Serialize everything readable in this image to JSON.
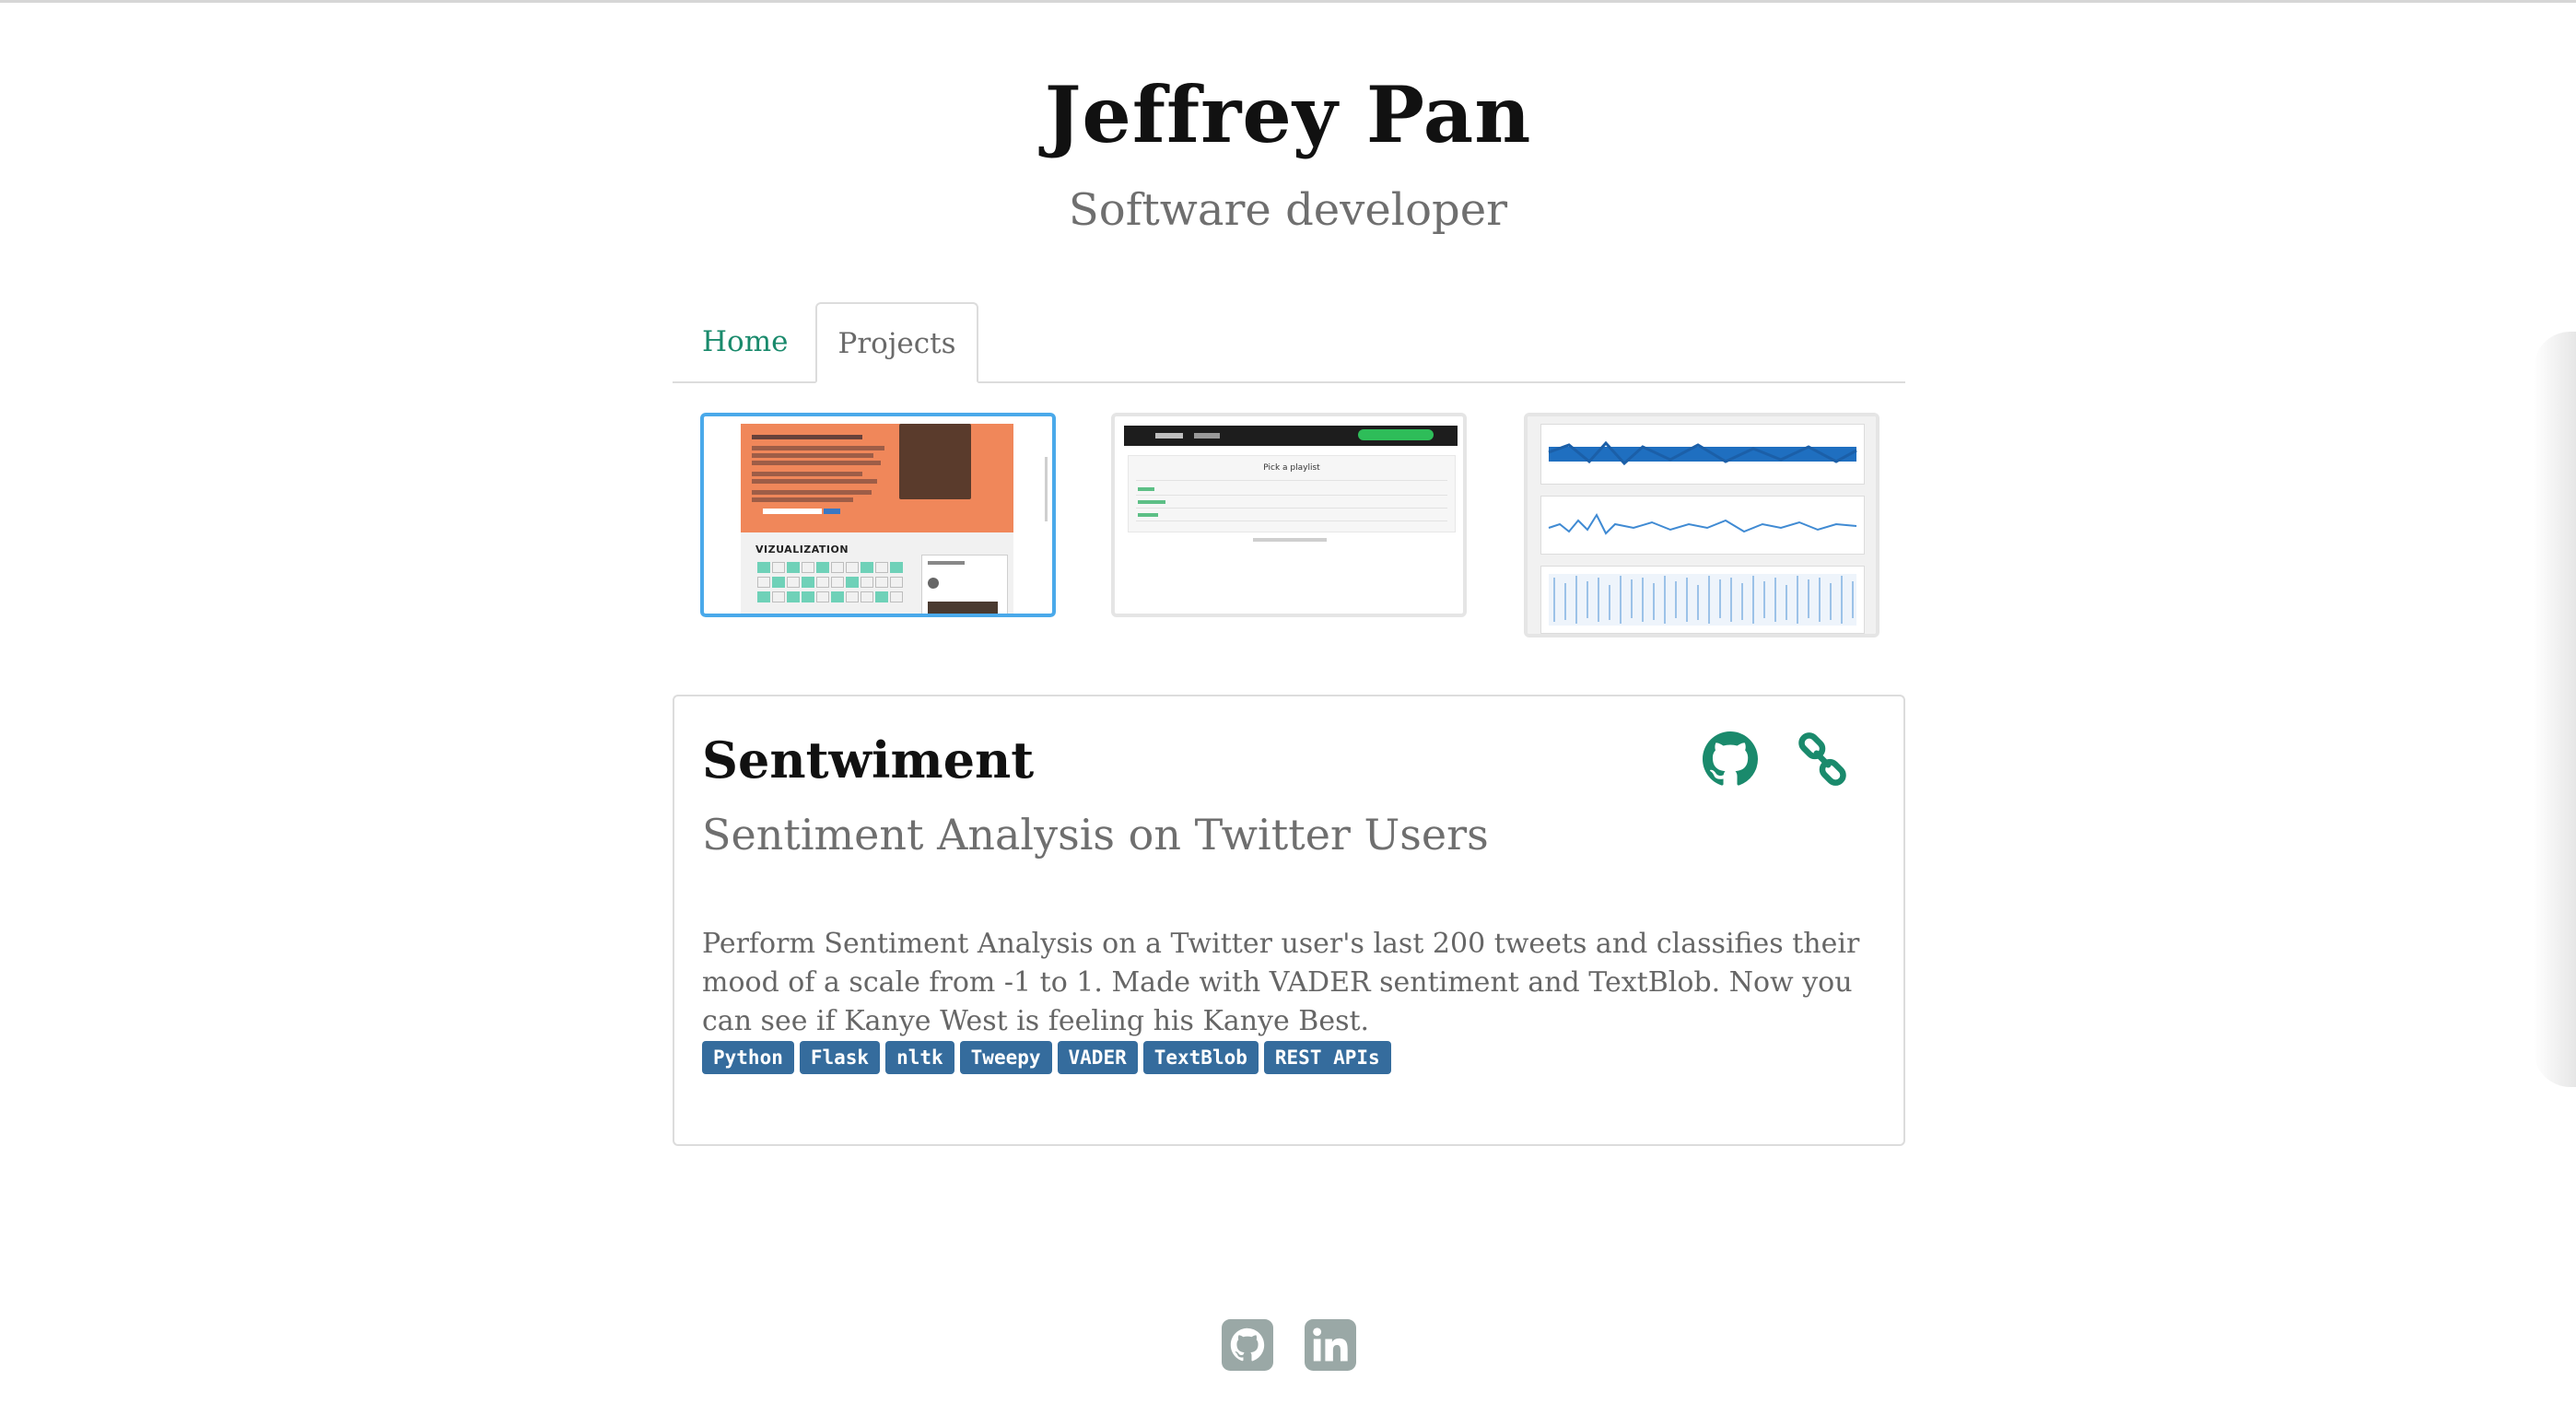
{
  "header": {
    "name": "Jeffrey Pan",
    "role": "Software developer"
  },
  "tabs": [
    {
      "label": "Home",
      "active": false
    },
    {
      "label": "Projects",
      "active": true
    }
  ],
  "carousel": {
    "thumbnails": [
      {
        "name": "sentwiment-screenshot",
        "selected": true,
        "caption": "VIZUALIZATION"
      },
      {
        "name": "spotify-app-screenshot",
        "selected": false,
        "caption": "Pick a playlist"
      },
      {
        "name": "signal-plot-screenshot",
        "selected": false
      }
    ],
    "page_dots": [
      true,
      false
    ]
  },
  "project": {
    "title": "Sentwiment",
    "subtitle": "Sentiment Analysis on Twitter Users",
    "description": "Perform Sentiment Analysis on a Twitter user's last 200 tweets and classifies their mood of a scale from -1 to 1. Made with VADER sentiment and TextBlob. Now you can see if Kanye West is feeling his Kanye Best.",
    "tags": [
      "Python",
      "Flask",
      "nltk",
      "Tweepy",
      "VADER",
      "TextBlob",
      "REST APIs"
    ],
    "icons": {
      "github": "github-icon",
      "link": "link-icon"
    }
  },
  "footer": {
    "icons": [
      "github-icon",
      "linkedin-icon"
    ]
  },
  "colors": {
    "accent_green": "#1a8a6c",
    "tag_blue": "#356c9d",
    "carousel_blue": "#3a9fe0",
    "footer_grey": "#9aa8a6"
  }
}
